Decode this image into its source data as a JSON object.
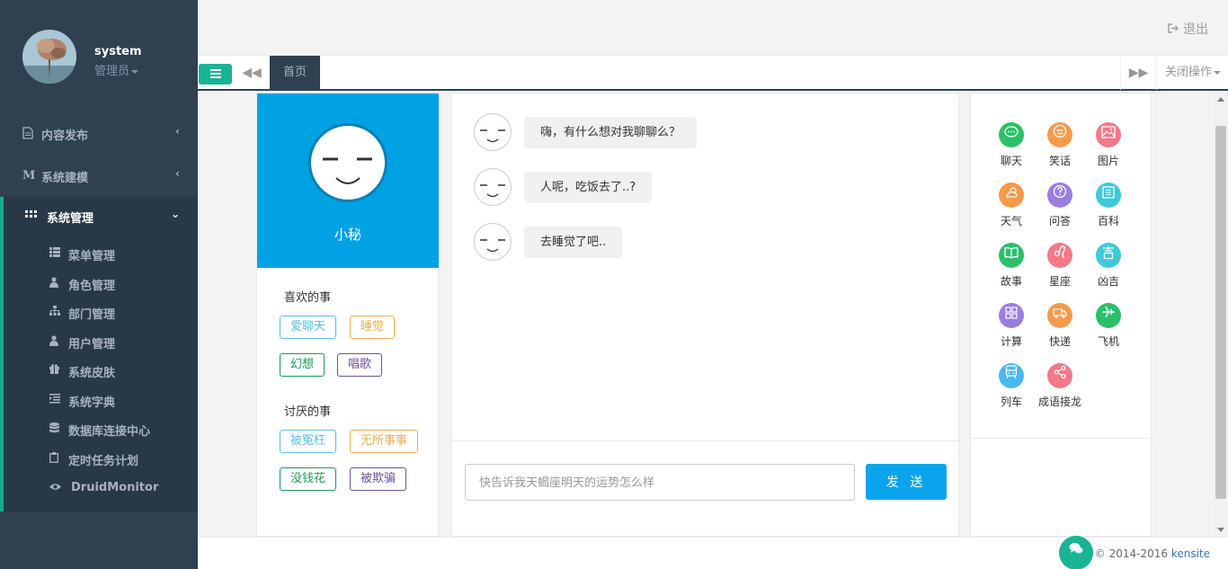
{
  "profile": {
    "name": "system",
    "role": "管理员"
  },
  "nav": [
    {
      "label": "内容发布",
      "icon": "file-icon"
    },
    {
      "label": "系统建模",
      "icon": "m-icon"
    },
    {
      "label": "系统管理",
      "icon": "grid-icon"
    }
  ],
  "submenu": [
    {
      "label": "菜单管理",
      "icon": "list-icon"
    },
    {
      "label": "角色管理",
      "icon": "user-icon"
    },
    {
      "label": "部门管理",
      "icon": "sitemap-icon"
    },
    {
      "label": "用户管理",
      "icon": "user-icon"
    },
    {
      "label": "系统皮肤",
      "icon": "gift-icon"
    },
    {
      "label": "系统字典",
      "icon": "indent-icon"
    },
    {
      "label": "数据库连接中心",
      "icon": "database-icon"
    },
    {
      "label": "定时任务计划",
      "icon": "clipboard-icon"
    },
    {
      "label": "DruidMonitor",
      "icon": "eye-icon"
    }
  ],
  "topbar": {
    "logout": "退出"
  },
  "tabs": {
    "home": "首页",
    "close_ops": "关闭操作"
  },
  "robot": {
    "name": "小秘"
  },
  "likes": {
    "title": "喜欢的事",
    "tags": [
      "爱聊天",
      "睡觉",
      "幻想",
      "唱歌"
    ]
  },
  "dislikes": {
    "title": "讨厌的事",
    "tags": [
      "被冤枉",
      "无所事事",
      "没钱花",
      "被欺骗"
    ]
  },
  "tag_colors": [
    "#5bc0de",
    "#f0ad4e",
    "#1c9a55",
    "#6f5499"
  ],
  "chat": {
    "messages": [
      "嗨，有什么想对我聊聊么？",
      "人呢，吃饭去了..?",
      "去睡觉了吧.."
    ],
    "input_placeholder": "快告诉我天蝎座明天的运势怎么样",
    "send_label": "发 送"
  },
  "skills": [
    {
      "label": "聊天",
      "color": "#2bbf6a",
      "icon": "chat-bubble-icon"
    },
    {
      "label": "笑话",
      "color": "#f59a4b",
      "icon": "smile-icon"
    },
    {
      "label": "图片",
      "color": "#f2788a",
      "icon": "picture-icon"
    },
    {
      "label": "天气",
      "color": "#f59a4b",
      "icon": "weather-icon"
    },
    {
      "label": "问答",
      "color": "#9b7de0",
      "icon": "question-icon"
    },
    {
      "label": "百科",
      "color": "#3ec9d6",
      "icon": "book-list-icon"
    },
    {
      "label": "故事",
      "color": "#2bbf6a",
      "icon": "book-icon"
    },
    {
      "label": "星座",
      "color": "#f2788a",
      "icon": "leo-icon"
    },
    {
      "label": "凶吉",
      "color": "#3ec9d6",
      "icon": "fortune-icon"
    },
    {
      "label": "计算",
      "color": "#9b7de0",
      "icon": "calculator-icon"
    },
    {
      "label": "快递",
      "color": "#f59a4b",
      "icon": "truck-icon"
    },
    {
      "label": "飞机",
      "color": "#2bbf6a",
      "icon": "airplane-icon"
    },
    {
      "label": "列车",
      "color": "#4ab8f0",
      "icon": "train-icon"
    },
    {
      "label": "成语接龙",
      "color": "#f2788a",
      "icon": "share-icon"
    }
  ],
  "footer": {
    "copyright": "© 2014-2016",
    "link": "kensite"
  }
}
